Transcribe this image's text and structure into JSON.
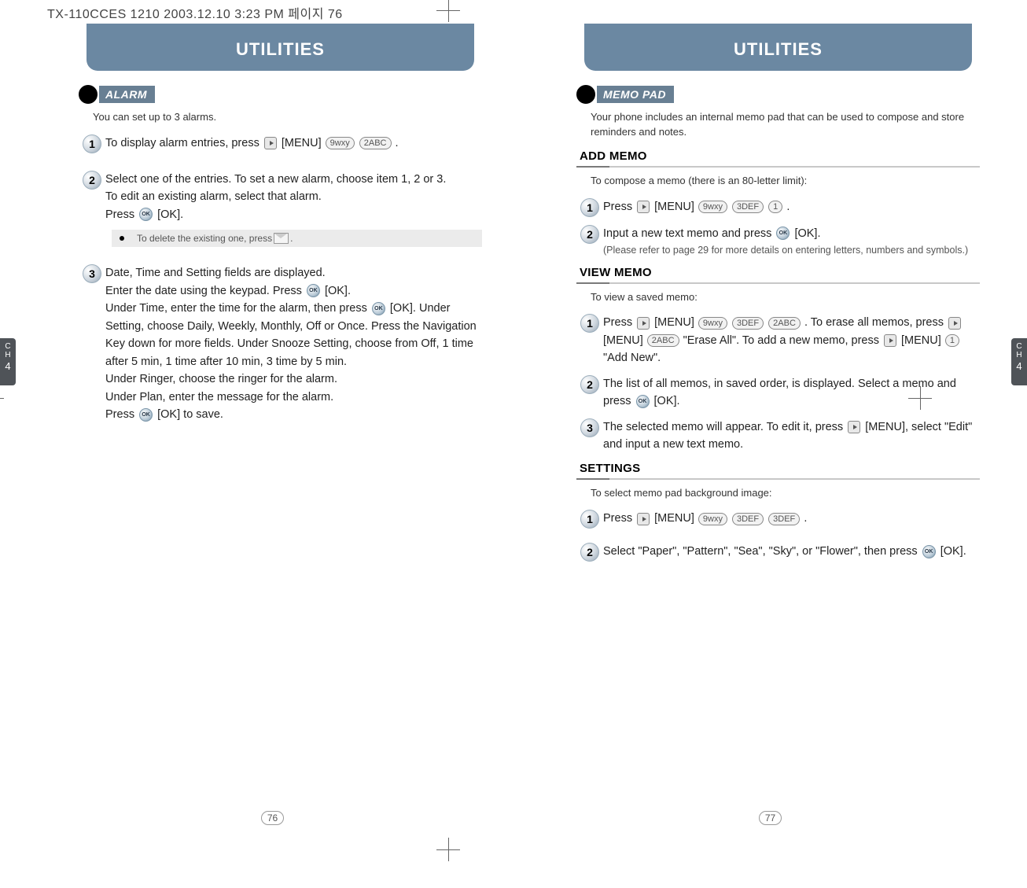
{
  "header_stamp": "TX-110CCES 1210  2003.12.10 3:23 PM  페이지 76",
  "side_tab": {
    "ch": "C\nH",
    "num": "4"
  },
  "left": {
    "title": "UTILITIES",
    "section": "ALARM",
    "intro": "You can set up to 3 alarms.",
    "steps": {
      "s1": "To display alarm entries, press ",
      "s1_after": "[MENU] ",
      "s1_tail": ".",
      "s2a": "Select one of the entries.  To set a new alarm, choose item 1, 2 or 3.",
      "s2b": "To edit an existing alarm, select that alarm.",
      "s2c_pre": "Press ",
      "s2c_post": "[OK].",
      "note": "To delete the existing one, press ",
      "note_tail": ".",
      "s3a": "Date, Time and Setting fields are displayed.",
      "s3b_pre": "Enter the date using the keypad.  Press ",
      "s3b_post": "[OK].",
      "s3c_pre": "Under Time, enter the time for the alarm, then press ",
      "s3c_post": "[OK].  Under Setting, choose Daily, Weekly, Monthly, Off or Once.  Press the Navigation Key down for more fields.  Under Snooze Setting, choose from Off, 1 time after 5 min, 1 time after 10 min, 3 time by 5 min.",
      "s3d": "Under Ringer, choose the ringer for the alarm.",
      "s3e": "Under Plan, enter the message for the alarm.",
      "s3f_pre": "Press ",
      "s3f_post": "[OK] to save."
    },
    "page_num": "76"
  },
  "right": {
    "title": "UTILITIES",
    "section": "MEMO PAD",
    "intro": "Your phone includes an internal memo pad that can be used to compose and store reminders and notes.",
    "add": {
      "head": "ADD MEMO",
      "intro": "To compose a memo (there is an 80-letter limit):",
      "s1_pre": "Press ",
      "s1_mid": "[MENU] ",
      "s1_tail": ".",
      "s2_pre": "Input a new text memo and press ",
      "s2_post": "[OK].",
      "s2_note": "(Please refer to page 29 for more details on entering letters, numbers and symbols.)"
    },
    "view": {
      "head": "VIEW MEMO",
      "intro": "To view a saved memo:",
      "s1_pre": "Press  ",
      "s1_menu": "[MENU] ",
      "s1_mid1": ". To erase all memos, press  ",
      "s1_menu2": "[MENU] ",
      "s1_mid2": "\"Erase All\".  To add a new memo, press  ",
      "s1_menu3": "[MENU] ",
      "s1_tail": "\"Add New\".",
      "s2_pre": "The list of all memos, in saved order, is displayed.  Select a memo and press ",
      "s2_post": "[OK].",
      "s3_pre": "The selected memo will appear.  To edit it, press  ",
      "s3_mid": "[MENU], select \"Edit\" and input a new text memo."
    },
    "settings": {
      "head": "SETTINGS",
      "intro": "To select memo pad background image:",
      "s1_pre": "Press  ",
      "s1_mid": "[MENU] ",
      "s1_tail": ".",
      "s2_pre": "Select \"Paper\", \"Pattern\", \"Sea\", \"Sky\", or \"Flower\", then press ",
      "s2_post": "[OK]."
    },
    "page_num": "77"
  },
  "keys": {
    "k9": "9wxy",
    "k2": "2ABC",
    "k3": "3DEF",
    "k1": "1",
    "ok": "OK"
  }
}
